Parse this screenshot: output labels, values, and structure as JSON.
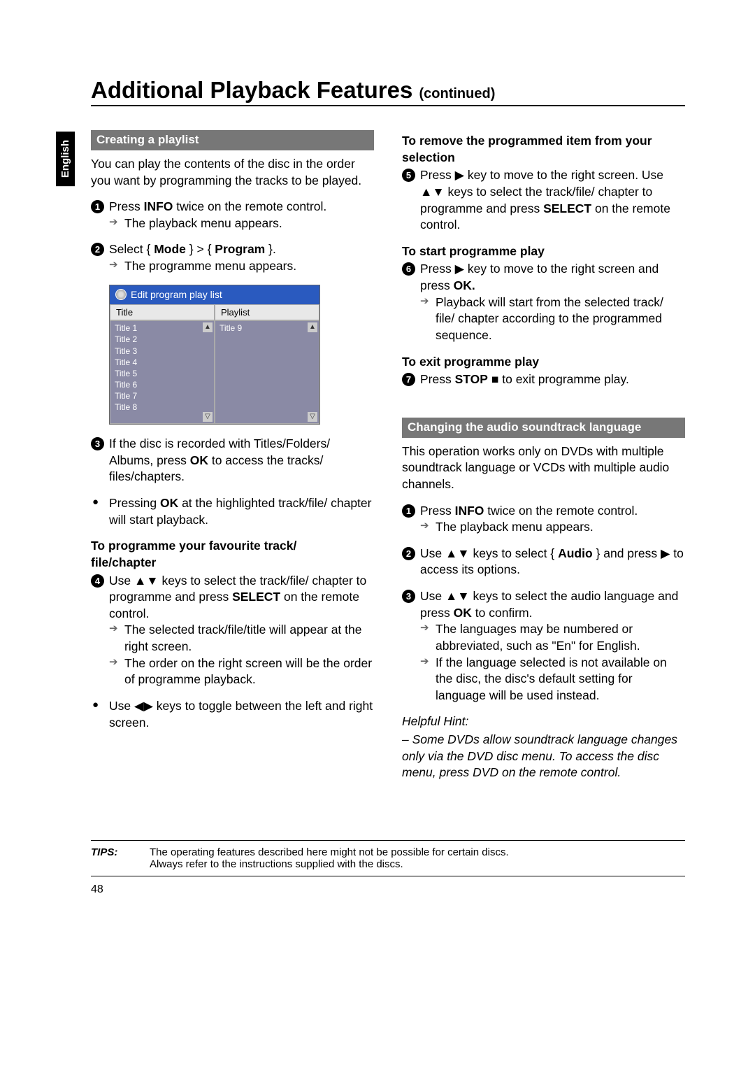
{
  "language_tab": "English",
  "heading": {
    "main": "Additional Playback Features",
    "suffix": "(continued)"
  },
  "left": {
    "section1": "Creating a playlist",
    "intro": "You can play the contents of the disc in the order you want by programming the tracks to be played.",
    "step1a": "Press ",
    "step1b": "INFO",
    "step1c": " twice on the remote control.",
    "step1res": "The playback menu appears.",
    "step2a": "Select { ",
    "step2b": "Mode",
    "step2c": " } > { ",
    "step2d": "Program",
    "step2e": " }.",
    "step2res": "The programme menu appears.",
    "shot": {
      "title": "Edit program play list",
      "hdr1": "Title",
      "hdr2": "Playlist",
      "titles": [
        "Title 1",
        "Title 2",
        "Title 3",
        "Title 4",
        "Title 5",
        "Title 6",
        "Title 7",
        "Title 8"
      ],
      "playlist": [
        "Title 9"
      ]
    },
    "step3a": "If the disc is recorded with Titles/Folders/ Albums, press ",
    "step3b": "OK",
    "step3c": " to access the tracks/ files/chapters.",
    "bullet1a": "Pressing ",
    "bullet1b": "OK",
    "bullet1c": " at the highlighted track/file/ chapter will start playback.",
    "sub1": "To programme your favourite track/\nfile/chapter",
    "step4a": "Use ▲▼ keys to select the track/file/ chapter to programme and press ",
    "step4b": "SELECT",
    "step4c": " on the remote control.",
    "step4res1": "The selected track/file/title will appear at the right screen.",
    "step4res2": "The order on the right screen will be the order of programme playback.",
    "bullet2": "Use ◀▶ keys to toggle between the left and right screen."
  },
  "right": {
    "sub1": "To remove the programmed item from your selection",
    "step5a": "Press ▶ key to move to the right screen. Use ▲▼ keys to select the track/file/ chapter to programme and press ",
    "step5b": "SELECT",
    "step5c": " on the remote control.",
    "sub2": "To start programme play",
    "step6a": "Press ▶ key to move to the right screen and press ",
    "step6b": "OK.",
    "step6res": "Playback will start from the selected track/ file/ chapter according to the programmed sequence.",
    "sub3": "To exit programme play",
    "step7a": "Press ",
    "step7b": "STOP",
    "step7c": " ■ to exit programme play.",
    "section2": "Changing the audio soundtrack language",
    "intro2": "This operation works only on DVDs with multiple soundtrack language or VCDs with multiple audio channels.",
    "s2step1a": "Press ",
    "s2step1b": "INFO",
    "s2step1c": " twice on the remote control.",
    "s2step1res": "The playback menu appears.",
    "s2step2a": "Use ▲▼ keys to select { ",
    "s2step2b": "Audio",
    "s2step2c": " } and press ▶ to access its options.",
    "s2step3a": "Use ▲▼ keys to select the audio language and press ",
    "s2step3b": "OK",
    "s2step3c": " to confirm.",
    "s2step3res1": "The languages may be numbered or abbreviated, such as \"En\" for English.",
    "s2step3res2": "If the language selected is not available on the disc, the disc's default setting for language will be used instead.",
    "hint_label": "Helpful Hint:",
    "hint_body": "– Some DVDs allow soundtrack language changes only via the DVD disc menu. To access the disc menu, press DVD on the remote control."
  },
  "tips": {
    "label": "TIPS:",
    "line1": "The operating features described here might not be possible for certain discs.",
    "line2": "Always refer to the instructions supplied with the discs."
  },
  "page_number": "48"
}
